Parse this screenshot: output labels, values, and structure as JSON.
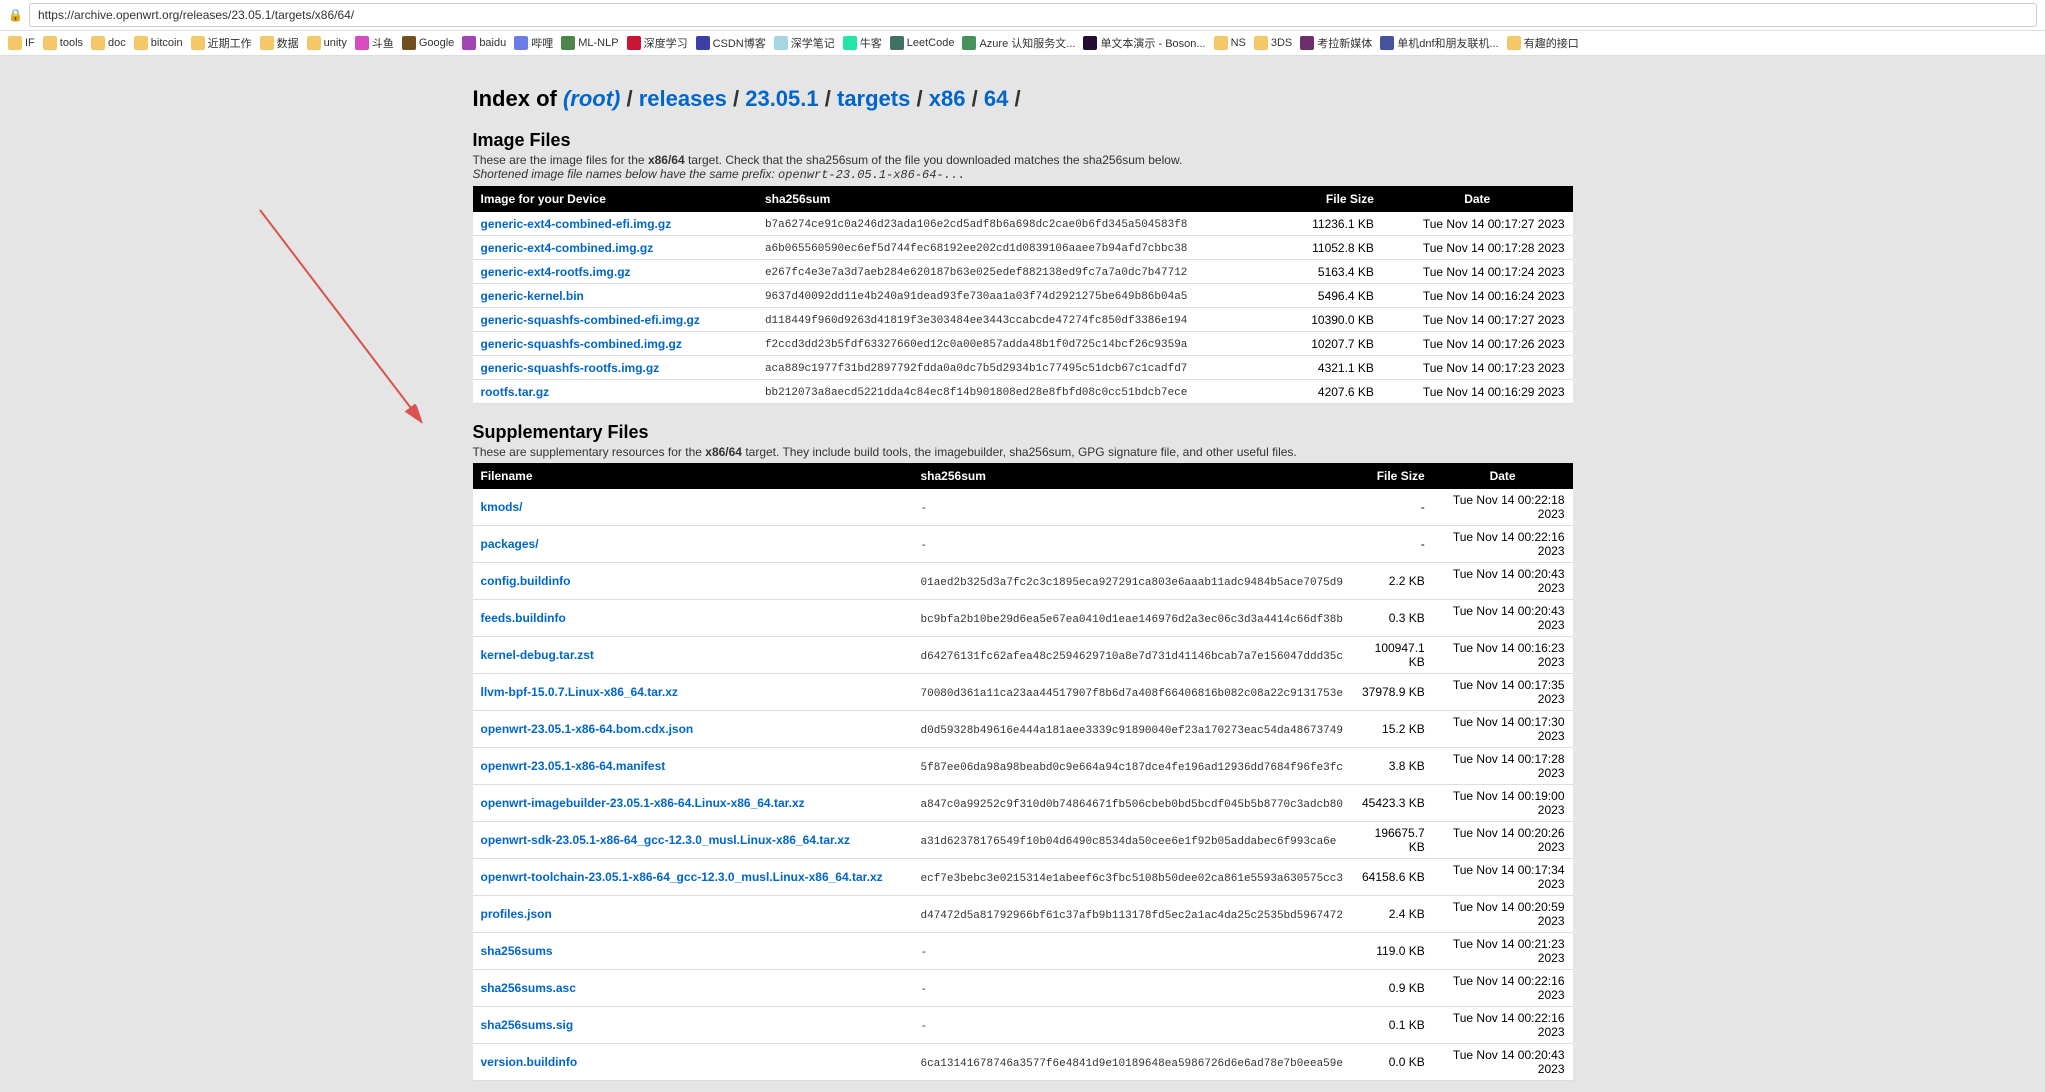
{
  "url": "https://archive.openwrt.org/releases/23.05.1/targets/x86/64/",
  "bookmarks": [
    {
      "label": "IF",
      "type": "folder"
    },
    {
      "label": "tools",
      "type": "folder"
    },
    {
      "label": "doc",
      "type": "folder"
    },
    {
      "label": "bitcoin",
      "type": "folder"
    },
    {
      "label": "近期工作",
      "type": "folder"
    },
    {
      "label": "数据",
      "type": "folder"
    },
    {
      "label": "unity",
      "type": "folder"
    },
    {
      "label": "斗鱼",
      "type": "site"
    },
    {
      "label": "Google",
      "type": "site"
    },
    {
      "label": "baidu",
      "type": "site"
    },
    {
      "label": "哔哩",
      "type": "site"
    },
    {
      "label": "ML-NLP",
      "type": "site"
    },
    {
      "label": "深度学习",
      "type": "site"
    },
    {
      "label": "CSDN博客",
      "type": "site"
    },
    {
      "label": "深学笔记",
      "type": "site"
    },
    {
      "label": "牛客",
      "type": "site"
    },
    {
      "label": "LeetCode",
      "type": "site"
    },
    {
      "label": "Azure 认知服务文...",
      "type": "site"
    },
    {
      "label": "单文本演示 - Boson...",
      "type": "site"
    },
    {
      "label": "NS",
      "type": "folder"
    },
    {
      "label": "3DS",
      "type": "folder"
    },
    {
      "label": "考拉新媒体",
      "type": "site"
    },
    {
      "label": "单机dnf和朋友联机...",
      "type": "site"
    },
    {
      "label": "有趣的接口",
      "type": "folder"
    }
  ],
  "breadcrumb": {
    "prefix": "Index of ",
    "root": "(root)",
    "parts": [
      "releases",
      "23.05.1",
      "targets",
      "x86",
      "64"
    ]
  },
  "imageFiles": {
    "title": "Image Files",
    "desc1": "These are the image files for the ",
    "descBold": "x86/64",
    "desc2": " target. Check that the sha256sum of the file you downloaded matches the sha256sum below.",
    "desc3": "Shortened image file names below have the same prefix: ",
    "descMono": "openwrt-23.05.1-x86-64-...",
    "headers": [
      "Image for your Device",
      "sha256sum",
      "File Size",
      "Date"
    ],
    "rows": [
      {
        "name": "generic-ext4-combined-efi.img.gz",
        "sha": "b7a6274ce91c0a246d23ada106e2cd5adf8b6a698dc2cae0b6fd345a504583f8",
        "size": "11236.1 KB",
        "date": "Tue Nov 14 00:17:27 2023"
      },
      {
        "name": "generic-ext4-combined.img.gz",
        "sha": "a6b065560590ec6ef5d744fec68192ee202cd1d0839106aaee7b94afd7cbbc38",
        "size": "11052.8 KB",
        "date": "Tue Nov 14 00:17:28 2023"
      },
      {
        "name": "generic-ext4-rootfs.img.gz",
        "sha": "e267fc4e3e7a3d7aeb284e620187b63e025edef882138ed9fc7a7a0dc7b47712",
        "size": "5163.4 KB",
        "date": "Tue Nov 14 00:17:24 2023"
      },
      {
        "name": "generic-kernel.bin",
        "sha": "9637d40092dd11e4b240a91dead93fe730aa1a03f74d2921275be649b86b04a5",
        "size": "5496.4 KB",
        "date": "Tue Nov 14 00:16:24 2023"
      },
      {
        "name": "generic-squashfs-combined-efi.img.gz",
        "sha": "d118449f960d9263d41819f3e303484ee3443ccabcde47274fc850df3386e194",
        "size": "10390.0 KB",
        "date": "Tue Nov 14 00:17:27 2023"
      },
      {
        "name": "generic-squashfs-combined.img.gz",
        "sha": "f2ccd3dd23b5fdf63327660ed12c0a00e857adda48b1f0d725c14bcf26c9359a",
        "size": "10207.7 KB",
        "date": "Tue Nov 14 00:17:26 2023"
      },
      {
        "name": "generic-squashfs-rootfs.img.gz",
        "sha": "aca889c1977f31bd2897792fdda0a0dc7b5d2934b1c77495c51dcb67c1cadfd7",
        "size": "4321.1 KB",
        "date": "Tue Nov 14 00:17:23 2023"
      },
      {
        "name": "rootfs.tar.gz",
        "sha": "bb212073a8aecd5221dda4c84ec8f14b901808ed28e8fbfd08c0cc51bdcb7ece",
        "size": "4207.6 KB",
        "date": "Tue Nov 14 00:16:29 2023"
      }
    ]
  },
  "suppFiles": {
    "title": "Supplementary Files",
    "desc1": "These are supplementary resources for the ",
    "descBold": "x86/64",
    "desc2": " target. They include build tools, the imagebuilder, sha256sum, GPG signature file, and other useful files.",
    "headers": [
      "Filename",
      "sha256sum",
      "File Size",
      "Date"
    ],
    "rows": [
      {
        "name": "kmods/",
        "sha": "-",
        "size": "-",
        "date": "Tue Nov 14 00:22:18 2023"
      },
      {
        "name": "packages/",
        "sha": "-",
        "size": "-",
        "date": "Tue Nov 14 00:22:16 2023"
      },
      {
        "name": "config.buildinfo",
        "sha": "01aed2b325d3a7fc2c3c1895eca927291ca803e6aaab11adc9484b5ace7075d9",
        "size": "2.2 KB",
        "date": "Tue Nov 14 00:20:43 2023"
      },
      {
        "name": "feeds.buildinfo",
        "sha": "bc9bfa2b10be29d6ea5e67ea0410d1eae146976d2a3ec06c3d3a4414c66df38b",
        "size": "0.3 KB",
        "date": "Tue Nov 14 00:20:43 2023"
      },
      {
        "name": "kernel-debug.tar.zst",
        "sha": "d64276131fc62afea48c2594629710a8e7d731d41146bcab7a7e156047ddd35c",
        "size": "100947.1 KB",
        "date": "Tue Nov 14 00:16:23 2023"
      },
      {
        "name": "llvm-bpf-15.0.7.Linux-x86_64.tar.xz",
        "sha": "70080d361a11ca23aa44517907f8b6d7a408f66406816b082c08a22c9131753e",
        "size": "37978.9 KB",
        "date": "Tue Nov 14 00:17:35 2023"
      },
      {
        "name": "openwrt-23.05.1-x86-64.bom.cdx.json",
        "sha": "d0d59328b49616e444a181aee3339c91890040ef23a170273eac54da48673749",
        "size": "15.2 KB",
        "date": "Tue Nov 14 00:17:30 2023"
      },
      {
        "name": "openwrt-23.05.1-x86-64.manifest",
        "sha": "5f87ee06da98a98beabd0c9e664a94c187dce4fe196ad12936dd7684f96fe3fc",
        "size": "3.8 KB",
        "date": "Tue Nov 14 00:17:28 2023"
      },
      {
        "name": "openwrt-imagebuilder-23.05.1-x86-64.Linux-x86_64.tar.xz",
        "sha": "a847c0a99252c9f310d0b74864671fb506cbeb0bd5bcdf045b5b8770c3adcb80",
        "size": "45423.3 KB",
        "date": "Tue Nov 14 00:19:00 2023"
      },
      {
        "name": "openwrt-sdk-23.05.1-x86-64_gcc-12.3.0_musl.Linux-x86_64.tar.xz",
        "sha": "a31d62378176549f10b04d6490c8534da50cee6e1f92b05addabec6f993ca6e",
        "size": "196675.7 KB",
        "date": "Tue Nov 14 00:20:26 2023"
      },
      {
        "name": "openwrt-toolchain-23.05.1-x86-64_gcc-12.3.0_musl.Linux-x86_64.tar.xz",
        "sha": "ecf7e3bebc3e0215314e1abeef6c3fbc5108b50dee02ca861e5593a630575cc3",
        "size": "64158.6 KB",
        "date": "Tue Nov 14 00:17:34 2023"
      },
      {
        "name": "profiles.json",
        "sha": "d47472d5a81792966bf61c37afb9b113178fd5ec2a1ac4da25c2535bd5967472",
        "size": "2.4 KB",
        "date": "Tue Nov 14 00:20:59 2023"
      },
      {
        "name": "sha256sums",
        "sha": "-",
        "size": "119.0 KB",
        "date": "Tue Nov 14 00:21:23 2023"
      },
      {
        "name": "sha256sums.asc",
        "sha": "-",
        "size": "0.9 KB",
        "date": "Tue Nov 14 00:22:16 2023"
      },
      {
        "name": "sha256sums.sig",
        "sha": "-",
        "size": "0.1 KB",
        "date": "Tue Nov 14 00:22:16 2023"
      },
      {
        "name": "version.buildinfo",
        "sha": "6ca13141678746a3577f6e4841d9e10189648ea5986726d6e6ad78e7b0eea59e",
        "size": "0.0 KB",
        "date": "Tue Nov 14 00:20:43 2023"
      }
    ]
  }
}
